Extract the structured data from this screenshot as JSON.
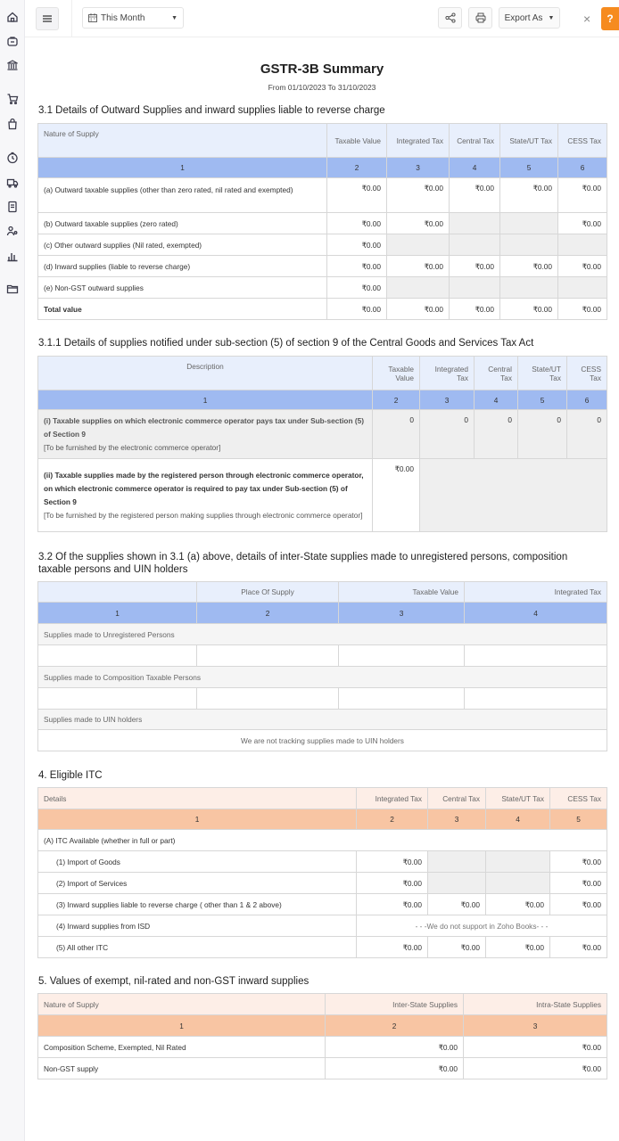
{
  "toolbar": {
    "period": "This Month",
    "export_label": "Export As",
    "help_label": "?",
    "close_label": "×"
  },
  "sidebar": {
    "icons": [
      "home-icon",
      "shopping-bag-icon",
      "bank-icon",
      "cart-icon",
      "purchase-bag-icon",
      "time-tracking-icon",
      "truck-icon",
      "document-icon",
      "contacts-icon",
      "reports-icon",
      "folder-icon"
    ]
  },
  "report": {
    "title": "GSTR-3B Summary",
    "date_range": "From 01/10/2023  To 31/10/2023"
  },
  "s31": {
    "heading": "3.1 Details of Outward Supplies and inward supplies liable to reverse charge",
    "headers": [
      "Nature of Supply",
      "Taxable Value",
      "Integrated Tax",
      "Central Tax",
      "State/UT Tax",
      "CESS Tax"
    ],
    "nums": [
      "1",
      "2",
      "3",
      "4",
      "5",
      "6"
    ],
    "rows": [
      {
        "label": "(a) Outward taxable supplies (other than zero rated, nil rated and exempted)",
        "v": [
          "₹0.00",
          "₹0.00",
          "₹0.00",
          "₹0.00",
          "₹0.00"
        ]
      },
      {
        "label": "(b) Outward taxable supplies (zero rated)",
        "v": [
          "₹0.00",
          "₹0.00",
          "",
          "",
          "₹0.00"
        ]
      },
      {
        "label": "(c) Other outward supplies (Nil rated, exempted)",
        "v": [
          "₹0.00",
          "",
          "",
          "",
          ""
        ]
      },
      {
        "label": "(d) Inward supplies (liable to reverse charge)",
        "v": [
          "₹0.00",
          "₹0.00",
          "₹0.00",
          "₹0.00",
          "₹0.00"
        ]
      },
      {
        "label": "(e) Non-GST outward supplies",
        "v": [
          "₹0.00",
          "",
          "",
          "",
          ""
        ]
      },
      {
        "label": "Total value",
        "v": [
          "₹0.00",
          "₹0.00",
          "₹0.00",
          "₹0.00",
          "₹0.00"
        ]
      }
    ]
  },
  "s311": {
    "heading": "3.1.1 Details of supplies notified under sub-section (5) of section 9 of the Central Goods and Services Tax Act",
    "headers": [
      "Description",
      "Taxable Value",
      "Integrated Tax",
      "Central Tax",
      "State/UT Tax",
      "CESS Tax"
    ],
    "nums": [
      "1",
      "2",
      "3",
      "4",
      "5",
      "6"
    ],
    "row1": {
      "title": "(i) Taxable supplies on which electronic commerce operator pays tax under Sub-section (5) of Section 9",
      "note": "[To be furnished by the electronic commerce operator]",
      "v": [
        "0",
        "0",
        "0",
        "0",
        "0"
      ]
    },
    "row2": {
      "title": "(ii) Taxable supplies made by the registered person through electronic commerce operator, on which electronic commerce operator is required to pay tax under Sub-section (5) of Section 9",
      "note": "[To be furnished by the registered person making supplies through electronic commerce operator]",
      "v": "₹0.00"
    }
  },
  "s32": {
    "heading": "3.2 Of the supplies shown in 3.1 (a) above, details of inter-State supplies made to unregistered persons, composition taxable persons and UIN holders",
    "headers": [
      "",
      "Place Of Supply",
      "Taxable Value",
      "Integrated Tax"
    ],
    "nums": [
      "1",
      "2",
      "3",
      "4"
    ],
    "band1": "Supplies made to Unregistered Persons",
    "band2": "Supplies made to Composition Taxable Persons",
    "band3": "Supplies made to UIN holders",
    "uin_note": "We are not tracking supplies made to UIN holders"
  },
  "s4": {
    "heading": "4. Eligible ITC",
    "headers": [
      "Details",
      "Integrated Tax",
      "Central Tax",
      "State/UT Tax",
      "CESS Tax"
    ],
    "nums": [
      "1",
      "2",
      "3",
      "4",
      "5"
    ],
    "group": "(A) ITC Available (whether in full or part)",
    "rows": [
      {
        "label": "(1) Import of Goods",
        "v": [
          "₹0.00",
          "",
          "",
          "₹0.00"
        ]
      },
      {
        "label": "(2) Import of Services",
        "v": [
          "₹0.00",
          "",
          "",
          "₹0.00"
        ]
      },
      {
        "label": "(3) Inward supplies liable to reverse charge ( other than 1 & 2 above)",
        "v": [
          "₹0.00",
          "₹0.00",
          "₹0.00",
          "₹0.00"
        ]
      },
      {
        "label": "(4) Inward supplies from ISD",
        "note": "- - -We do not support in Zoho Books- - -"
      },
      {
        "label": "(5) All other ITC",
        "v": [
          "₹0.00",
          "₹0.00",
          "₹0.00",
          "₹0.00"
        ]
      }
    ]
  },
  "s5": {
    "heading": "5. Values of exempt, nil-rated and non-GST inward supplies",
    "headers": [
      "Nature of Supply",
      "Inter-State Supplies",
      "Intra-State Supplies"
    ],
    "nums": [
      "1",
      "2",
      "3"
    ],
    "rows": [
      {
        "label": "Composition Scheme, Exempted, Nil Rated",
        "v": [
          "₹0.00",
          "₹0.00"
        ]
      },
      {
        "label": "Non-GST supply",
        "v": [
          "₹0.00",
          "₹0.00"
        ]
      }
    ]
  }
}
